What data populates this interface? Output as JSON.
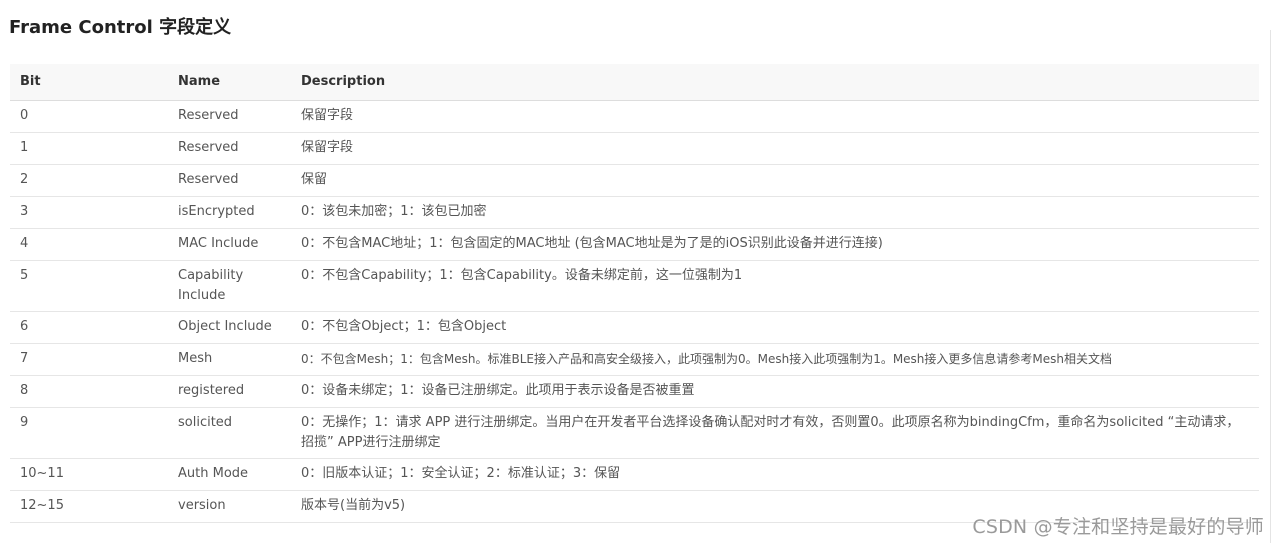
{
  "page": {
    "title": "Frame Control 字段定义",
    "watermark": "CSDN @专注和坚持是最好的导师"
  },
  "table": {
    "headers": {
      "bit": "Bit",
      "name": "Name",
      "description": "Description"
    },
    "rows": [
      {
        "bit": "0",
        "name": "Reserved",
        "description": "保留字段"
      },
      {
        "bit": "1",
        "name": "Reserved",
        "description": "保留字段"
      },
      {
        "bit": "2",
        "name": "Reserved",
        "description": "保留"
      },
      {
        "bit": "3",
        "name": "isEncrypted",
        "description": "0：该包未加密；1：该包已加密"
      },
      {
        "bit": "4",
        "name": "MAC Include",
        "description": "0：不包含MAC地址；1：包含固定的MAC地址 (包含MAC地址是为了是的iOS识别此设备并进行连接)"
      },
      {
        "bit": "5",
        "name": "Capability Include",
        "description": "0：不包含Capability；1：包含Capability。设备未绑定前，这一位强制为1"
      },
      {
        "bit": "6",
        "name": "Object Include",
        "description": "0：不包含Object；1：包含Object"
      },
      {
        "bit": "7",
        "name": "Mesh",
        "description": "0：不包含Mesh；1：包含Mesh。标准BLE接入产品和高安全级接入，此项强制为0。Mesh接入此项强制为1。Mesh接入更多信息请参考Mesh相关文档"
      },
      {
        "bit": "8",
        "name": "registered",
        "description": "0：设备未绑定；1：设备已注册绑定。此项用于表示设备是否被重置"
      },
      {
        "bit": "9",
        "name": "solicited",
        "description": "0：无操作；1：请求 APP 进行注册绑定。当用户在开发者平台选择设备确认配对时才有效，否则置0。此项原名称为bindingCfm，重命名为solicited “主动请求，招揽” APP进行注册绑定"
      },
      {
        "bit": "10~11",
        "name": "Auth Mode",
        "description": "0：旧版本认证；1：安全认证；2：标准认证；3：保留"
      },
      {
        "bit": "12~15",
        "name": "version",
        "description": "版本号(当前为v5)"
      }
    ]
  }
}
